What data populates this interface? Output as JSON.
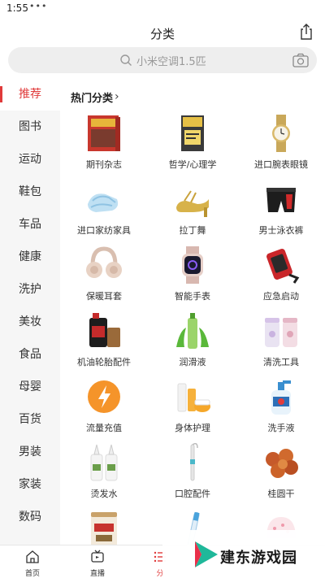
{
  "status_bar": {
    "time": "1:55",
    "dots": "•••"
  },
  "header": {
    "title": "分类"
  },
  "search": {
    "placeholder": "小米空调1.5匹"
  },
  "sidebar": {
    "items": [
      {
        "label": "推荐",
        "active": true
      },
      {
        "label": "图书"
      },
      {
        "label": "运动"
      },
      {
        "label": "鞋包"
      },
      {
        "label": "车品"
      },
      {
        "label": "健康"
      },
      {
        "label": "洗护"
      },
      {
        "label": "美妆"
      },
      {
        "label": "食品"
      },
      {
        "label": "母婴"
      },
      {
        "label": "百货"
      },
      {
        "label": "男装"
      },
      {
        "label": "家装"
      },
      {
        "label": "数码"
      }
    ]
  },
  "section": {
    "title": "热门分类",
    "chevron": "›"
  },
  "grid": {
    "items": [
      {
        "label": "期刊杂志",
        "icon": "magazine-icon"
      },
      {
        "label": "哲学/心理学",
        "icon": "book-icon"
      },
      {
        "label": "进口腕表眼镜",
        "icon": "watch-icon"
      },
      {
        "label": "进口家纺家具",
        "icon": "towel-icon"
      },
      {
        "label": "拉丁舞",
        "icon": "dance-shoe-icon"
      },
      {
        "label": "男士泳衣裤",
        "icon": "swim-trunks-icon"
      },
      {
        "label": "保暖耳套",
        "icon": "earmuffs-icon"
      },
      {
        "label": "智能手表",
        "icon": "smartwatch-icon"
      },
      {
        "label": "应急启动",
        "icon": "jump-starter-icon"
      },
      {
        "label": "机油轮胎配件",
        "icon": "engine-oil-icon"
      },
      {
        "label": "润滑液",
        "icon": "aloe-bottle-icon"
      },
      {
        "label": "清洗工具",
        "icon": "cleaning-jars-icon"
      },
      {
        "label": "流量充值",
        "icon": "lightning-icon"
      },
      {
        "label": "身体护理",
        "icon": "body-care-icon"
      },
      {
        "label": "洗手液",
        "icon": "hand-soap-icon"
      },
      {
        "label": "烫发水",
        "icon": "perm-bottles-icon"
      },
      {
        "label": "口腔配件",
        "icon": "oral-irrigator-icon"
      },
      {
        "label": "桂圆干",
        "icon": "dried-longan-icon"
      },
      {
        "label": "",
        "icon": "formula-can-icon"
      },
      {
        "label": "",
        "icon": "toothbrush-icon"
      },
      {
        "label": "",
        "icon": "baby-hat-icon"
      }
    ]
  },
  "bottom_nav": {
    "items": [
      {
        "label": "首页",
        "icon": "home-icon"
      },
      {
        "label": "直播",
        "icon": "tv-icon"
      },
      {
        "label": "分",
        "icon": "category-list-icon",
        "active": true
      }
    ]
  },
  "watermark": {
    "text": "建东游戏园"
  },
  "colors": {
    "accent": "#e03a3a",
    "sidebar_bg": "#f6f6f6",
    "search_bg": "#eeeeee"
  }
}
